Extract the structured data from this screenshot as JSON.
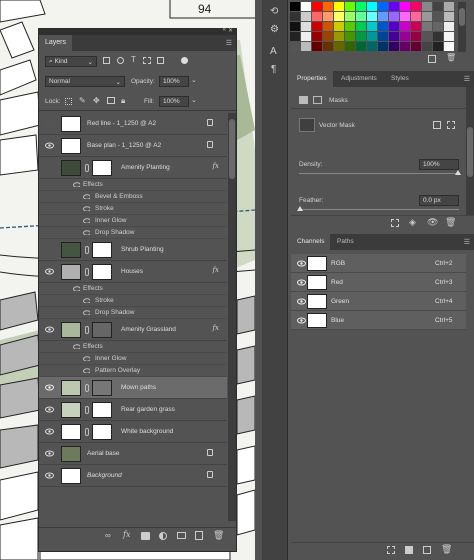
{
  "canvas": {
    "map_number": "94"
  },
  "layers_panel": {
    "tab_label": "Layers",
    "filter_kind": "Kind",
    "blend_mode": "Normal",
    "opacity_label": "Opacity:",
    "opacity_value": "100%",
    "lock_label": "Lock:",
    "fill_label": "Fill:",
    "fill_value": "100%",
    "layers": [
      {
        "name": "Red line - 1_1250 @ A2",
        "thumb": "#ffffff",
        "visible": false,
        "locked": true,
        "fx": false
      },
      {
        "name": "Base plan - 1_1250 @ A2",
        "thumb": "#ffffff",
        "visible": true,
        "locked": true,
        "fx": false
      },
      {
        "name": "Amenity Planting",
        "thumb": "#3e4a3a",
        "visible": false,
        "locked": false,
        "fx": true
      },
      {
        "name": "Shrub Planting",
        "thumb": "#465542",
        "visible": false,
        "locked": false,
        "fx": false
      },
      {
        "name": "Houses",
        "thumb": "#b0b0b0",
        "visible": true,
        "locked": false,
        "fx": true
      },
      {
        "name": "Amenity Grassland",
        "thumb": "#a9b89a",
        "visible": true,
        "locked": false,
        "fx": true
      },
      {
        "name": "Mown paths",
        "thumb": "#bcc9b0",
        "visible": true,
        "locked": false,
        "fx": false,
        "selected": true
      },
      {
        "name": "Rear garden grass",
        "thumb": "#c7d2bd",
        "visible": true,
        "locked": false,
        "fx": false
      },
      {
        "name": "White background",
        "thumb": "#ffffff",
        "visible": true,
        "locked": false,
        "fx": false
      },
      {
        "name": "Aerial base",
        "thumb": "#6d7a5c",
        "visible": true,
        "locked": true,
        "fx": false
      },
      {
        "name": "Background",
        "thumb": "#ffffff",
        "visible": true,
        "locked": true,
        "fx": false
      }
    ],
    "effects_amenity_planting": [
      "Effects",
      "Bevel & Emboss",
      "Stroke",
      "Inner Glow",
      "Drop Shadow"
    ],
    "effects_houses": [
      "Effects",
      "Stroke",
      "Drop Shadow"
    ],
    "effects_amenity_grassland": [
      "Effects",
      "Inner Glow",
      "Pattern Overlay"
    ]
  },
  "properties_panel": {
    "tabs": [
      "Properties",
      "Adjustments",
      "Styles"
    ],
    "masks_label": "Masks",
    "vector_mask_label": "Vector Mask",
    "density_label": "Density:",
    "density_value": "100%",
    "feather_label": "Feather:",
    "feather_value": "0.0 px"
  },
  "channels_panel": {
    "tabs": [
      "Channels",
      "Paths"
    ],
    "channels": [
      {
        "name": "RGB",
        "shortcut": "Ctrl+2"
      },
      {
        "name": "Red",
        "shortcut": "Ctrl+3"
      },
      {
        "name": "Green",
        "shortcut": "Ctrl+4"
      },
      {
        "name": "Blue",
        "shortcut": "Ctrl+5"
      }
    ]
  },
  "colors": {
    "panel_bg": "#535353",
    "panel_dark": "#3b3b3b",
    "selected_row": "#6b6b6b"
  }
}
